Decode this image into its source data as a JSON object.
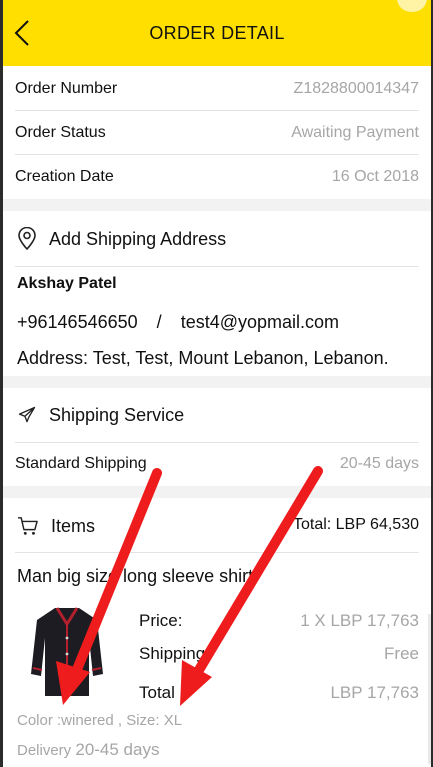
{
  "header": {
    "title": "ORDER DETAIL",
    "back_icon": "chevron-left-icon",
    "color": "#ffdf00"
  },
  "order": {
    "number_label": "Order Number",
    "number_value": "Z1828800014347",
    "status_label": "Order Status",
    "status_value": "Awaiting Payment",
    "date_label": "Creation Date",
    "date_value": "16 Oct 2018"
  },
  "address": {
    "heading": "Add Shipping Address",
    "icon": "location-pin-icon",
    "name": "Akshay Patel",
    "phone": "+96146546650",
    "separator": "/",
    "email": "test4@yopmail.com",
    "line": "Address:  Test, Test, Mount Lebanon, Lebanon."
  },
  "shipping": {
    "heading": "Shipping Service",
    "icon": "airplane-icon",
    "method": "Standard Shipping",
    "days": "20-45 days"
  },
  "items": {
    "heading": "Items",
    "icon": "cart-icon",
    "total": "Total:  LBP 64,530",
    "product_name": "Man big size long sleeve shirt",
    "price_label": "Price:",
    "price_value": "1 X LBP 17,763",
    "shipping_label": "Shipping",
    "shipping_value": "Free",
    "total_label": "Total",
    "total_value": "LBP 17,763",
    "attributes": "Color :winered , Size: XL",
    "delivery_label": "Delivery",
    "delivery_value": "20-45 days"
  },
  "annotation": {
    "arrow_color": "#ee1c1c"
  }
}
